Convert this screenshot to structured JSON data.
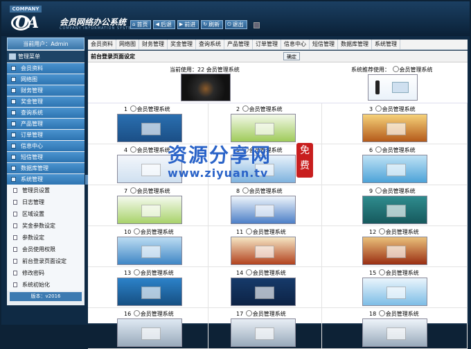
{
  "header": {
    "company": "COMPANY",
    "logo": "OA",
    "title": "会员网络办公系统",
    "subtitle": "COMPANY INFORMATION SYSTEM",
    "nav": [
      {
        "label": "首页",
        "icon": "home-icon",
        "glyph": "⌂"
      },
      {
        "label": "后退",
        "icon": "back-icon",
        "glyph": "◀"
      },
      {
        "label": "前进",
        "icon": "forward-icon",
        "glyph": "▶"
      },
      {
        "label": "刷新",
        "icon": "refresh-icon",
        "glyph": "↻"
      },
      {
        "label": "退出",
        "icon": "power-icon",
        "glyph": "⏻"
      }
    ]
  },
  "sidebar": {
    "user": "当前用户：Admin",
    "menu_title": "管理菜单",
    "items": [
      "会员资料",
      "网络图",
      "财务管理",
      "奖金管理",
      "查询系统",
      "产品管理",
      "订单管理",
      "信息中心",
      "短信管理",
      "数据库管理",
      "系统管理"
    ],
    "subitems": [
      "管理员设置",
      "日志管理",
      "区域设置",
      "奖金参数设定",
      "参数设定",
      "会员使用权限",
      "前台登录页面设定",
      "修改密码",
      "系统初始化"
    ],
    "footer": "版本：v2016"
  },
  "tabs": [
    "会员资料",
    "网络图",
    "财务管理",
    "奖金管理",
    "查询系统",
    "产品管理",
    "订单管理",
    "信息中心",
    "短信管理",
    "数据库管理",
    "系统管理"
  ],
  "content": {
    "title": "前台登录页面设定",
    "ok_button": "确定",
    "current_label": "当前使用：22 会员管理系统",
    "recommend_label": "系统推荐使用：",
    "recommend_option": "会员管理系统",
    "option_label": "会员管理系统",
    "templates": [
      "1",
      "2",
      "3",
      "4",
      "5",
      "6",
      "7",
      "8",
      "9",
      "10",
      "11",
      "12",
      "13",
      "14",
      "15",
      "16",
      "17",
      "18"
    ]
  },
  "watermark": {
    "line1": "资源分享网",
    "line2": "www.ziyuan.tv",
    "seal": "免费"
  },
  "colors": {
    "header_bg": "#0f2a44",
    "menu_blue": "#2d74b1",
    "watermark_blue": "#2a63c8",
    "seal_red": "#c81e1e"
  }
}
